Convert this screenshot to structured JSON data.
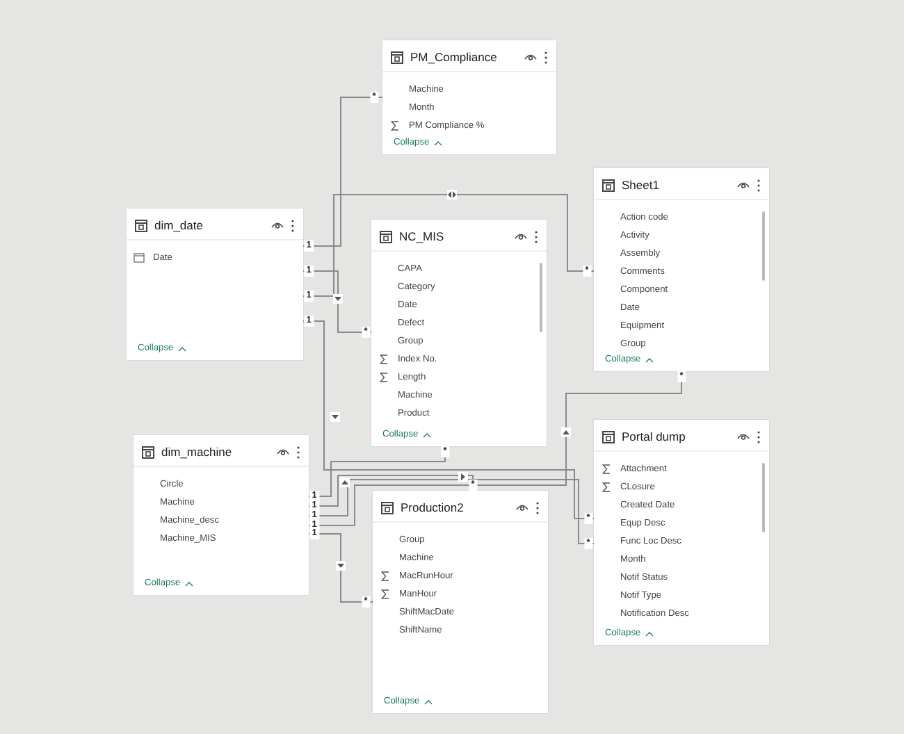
{
  "tables": [
    {
      "name": "PM_Compliance",
      "scrollable": false,
      "fields": [
        {
          "name": "Machine",
          "kind": "plain"
        },
        {
          "name": "Month",
          "kind": "plain"
        },
        {
          "name": "PM Compliance %",
          "kind": "sum"
        }
      ],
      "collapse": "Collapse"
    },
    {
      "name": "dim_date",
      "scrollable": false,
      "fields": [
        {
          "name": "Date",
          "kind": "date"
        }
      ],
      "collapse": "Collapse"
    },
    {
      "name": "NC_MIS",
      "scrollable": true,
      "fields": [
        {
          "name": "CAPA",
          "kind": "plain"
        },
        {
          "name": "Category",
          "kind": "plain"
        },
        {
          "name": "Date",
          "kind": "plain"
        },
        {
          "name": "Defect",
          "kind": "plain"
        },
        {
          "name": "Group",
          "kind": "plain"
        },
        {
          "name": "Index No.",
          "kind": "sum"
        },
        {
          "name": "Length",
          "kind": "sum"
        },
        {
          "name": "Machine",
          "kind": "plain"
        },
        {
          "name": "Product",
          "kind": "plain"
        }
      ],
      "collapse": "Collapse"
    },
    {
      "name": "Sheet1",
      "scrollable": true,
      "fields": [
        {
          "name": "Action code",
          "kind": "plain"
        },
        {
          "name": "Activity",
          "kind": "plain"
        },
        {
          "name": "Assembly",
          "kind": "plain"
        },
        {
          "name": "Comments",
          "kind": "plain"
        },
        {
          "name": "Component",
          "kind": "plain"
        },
        {
          "name": "Date",
          "kind": "plain"
        },
        {
          "name": "Equipment",
          "kind": "plain"
        },
        {
          "name": "Group",
          "kind": "plain"
        }
      ],
      "collapse": "Collapse"
    },
    {
      "name": "dim_machine",
      "scrollable": false,
      "fields": [
        {
          "name": "Circle",
          "kind": "plain"
        },
        {
          "name": "Machine",
          "kind": "plain"
        },
        {
          "name": "Machine_desc",
          "kind": "plain"
        },
        {
          "name": "Machine_MIS",
          "kind": "plain"
        }
      ],
      "collapse": "Collapse"
    },
    {
      "name": "Production2",
      "scrollable": false,
      "fields": [
        {
          "name": "Group",
          "kind": "plain"
        },
        {
          "name": "Machine",
          "kind": "plain"
        },
        {
          "name": "MacRunHour",
          "kind": "sum"
        },
        {
          "name": "ManHour",
          "kind": "sum"
        },
        {
          "name": "ShiftMacDate",
          "kind": "plain"
        },
        {
          "name": "ShiftName",
          "kind": "plain"
        }
      ],
      "collapse": "Collapse"
    },
    {
      "name": "Portal dump",
      "scrollable": true,
      "fields": [
        {
          "name": "Attachment",
          "kind": "sum"
        },
        {
          "name": "CLosure",
          "kind": "sum"
        },
        {
          "name": "Created Date",
          "kind": "plain"
        },
        {
          "name": "Equp Desc",
          "kind": "plain"
        },
        {
          "name": "Func Loc Desc",
          "kind": "plain"
        },
        {
          "name": "Month",
          "kind": "plain"
        },
        {
          "name": "Notif Status",
          "kind": "plain"
        },
        {
          "name": "Notif Type",
          "kind": "plain"
        },
        {
          "name": "Notification Desc",
          "kind": "plain"
        }
      ],
      "collapse": "Collapse"
    }
  ],
  "relationships": [
    {
      "one_end": "1",
      "many_end": "*",
      "kind": "plain"
    },
    {
      "one_end": "1",
      "many_end": "*",
      "kind": "single"
    },
    {
      "one_end": "1",
      "many_end": "*",
      "kind": "both"
    },
    {
      "one_end": "1",
      "many_end": "*",
      "kind": "single"
    },
    {
      "one_end": "1",
      "many_end": "*",
      "kind": "single"
    },
    {
      "one_end": "1",
      "many_end": "*",
      "kind": "single"
    },
    {
      "one_end": "1",
      "many_end": "*",
      "kind": "plain"
    },
    {
      "one_end": "1",
      "many_end": "*",
      "kind": "single"
    },
    {
      "one_end": "1",
      "many_end": "*",
      "kind": "single"
    }
  ]
}
